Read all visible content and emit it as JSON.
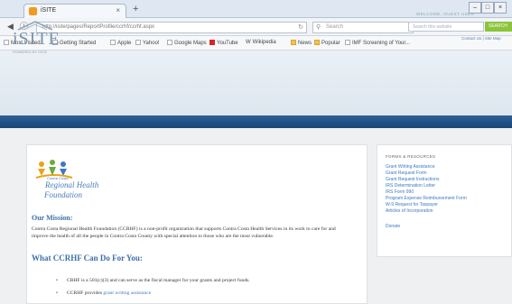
{
  "browser": {
    "tab_title": "iSITE",
    "tab_close": "×",
    "new_tab": "+",
    "window_buttons": [
      "–",
      "□",
      "×"
    ],
    "url": "http://isite/pages/ReportProfile/ccrhf/ccrhf.aspx",
    "search_placeholder": "Search",
    "bookmarks": [
      "Most Visited",
      "Getting Started",
      "Apple",
      "Yahoo!",
      "Google Maps",
      "YouTube",
      "Wikipedia",
      "News",
      "Popular",
      "IMF Screening of Your..."
    ]
  },
  "site_header": {
    "logo": "iSITE",
    "logo_sub": "POWERED BY ISITE",
    "welcome": "WELCOME, GUEST USER",
    "search_placeholder": "Search this website",
    "search_button": "SEARCH",
    "header_link": "Contact Us | Site Map"
  },
  "foundation": {
    "small": "Contra Costa",
    "line1": "Regional Health",
    "line2": "Foundation"
  },
  "main": {
    "mission_heading": "Our Mission:",
    "mission_text": "Contra Costa Regional Health Foundation (CCRHF) is a non-profit organization that supports Contra Costa Health Services in its work to care for and improve the health of all the people in Contra Costa County with special attention to those who are the most vulnerable.",
    "what_heading": "What CCRHF Can Do For You:",
    "bullets": [
      {
        "text": "CRHF is a 501(c)(3) and can serve as the fiscal manager for your grants and project funds.",
        "link": ""
      },
      {
        "text": "CCRHF provides ",
        "link": "grant writing assistance"
      }
    ]
  },
  "sidebar": {
    "title": "FORMS & RESOURCES",
    "links": [
      "Grant Writing Assistance",
      "Grant Request Form",
      "Grant Request Instructions",
      "IRS Determination Letter",
      "IRS Form 990",
      "Program Expense Reimbursement Form",
      "W-9 Request for Taxpayer",
      "Articles of Incorporation"
    ],
    "donate": "Donate"
  }
}
